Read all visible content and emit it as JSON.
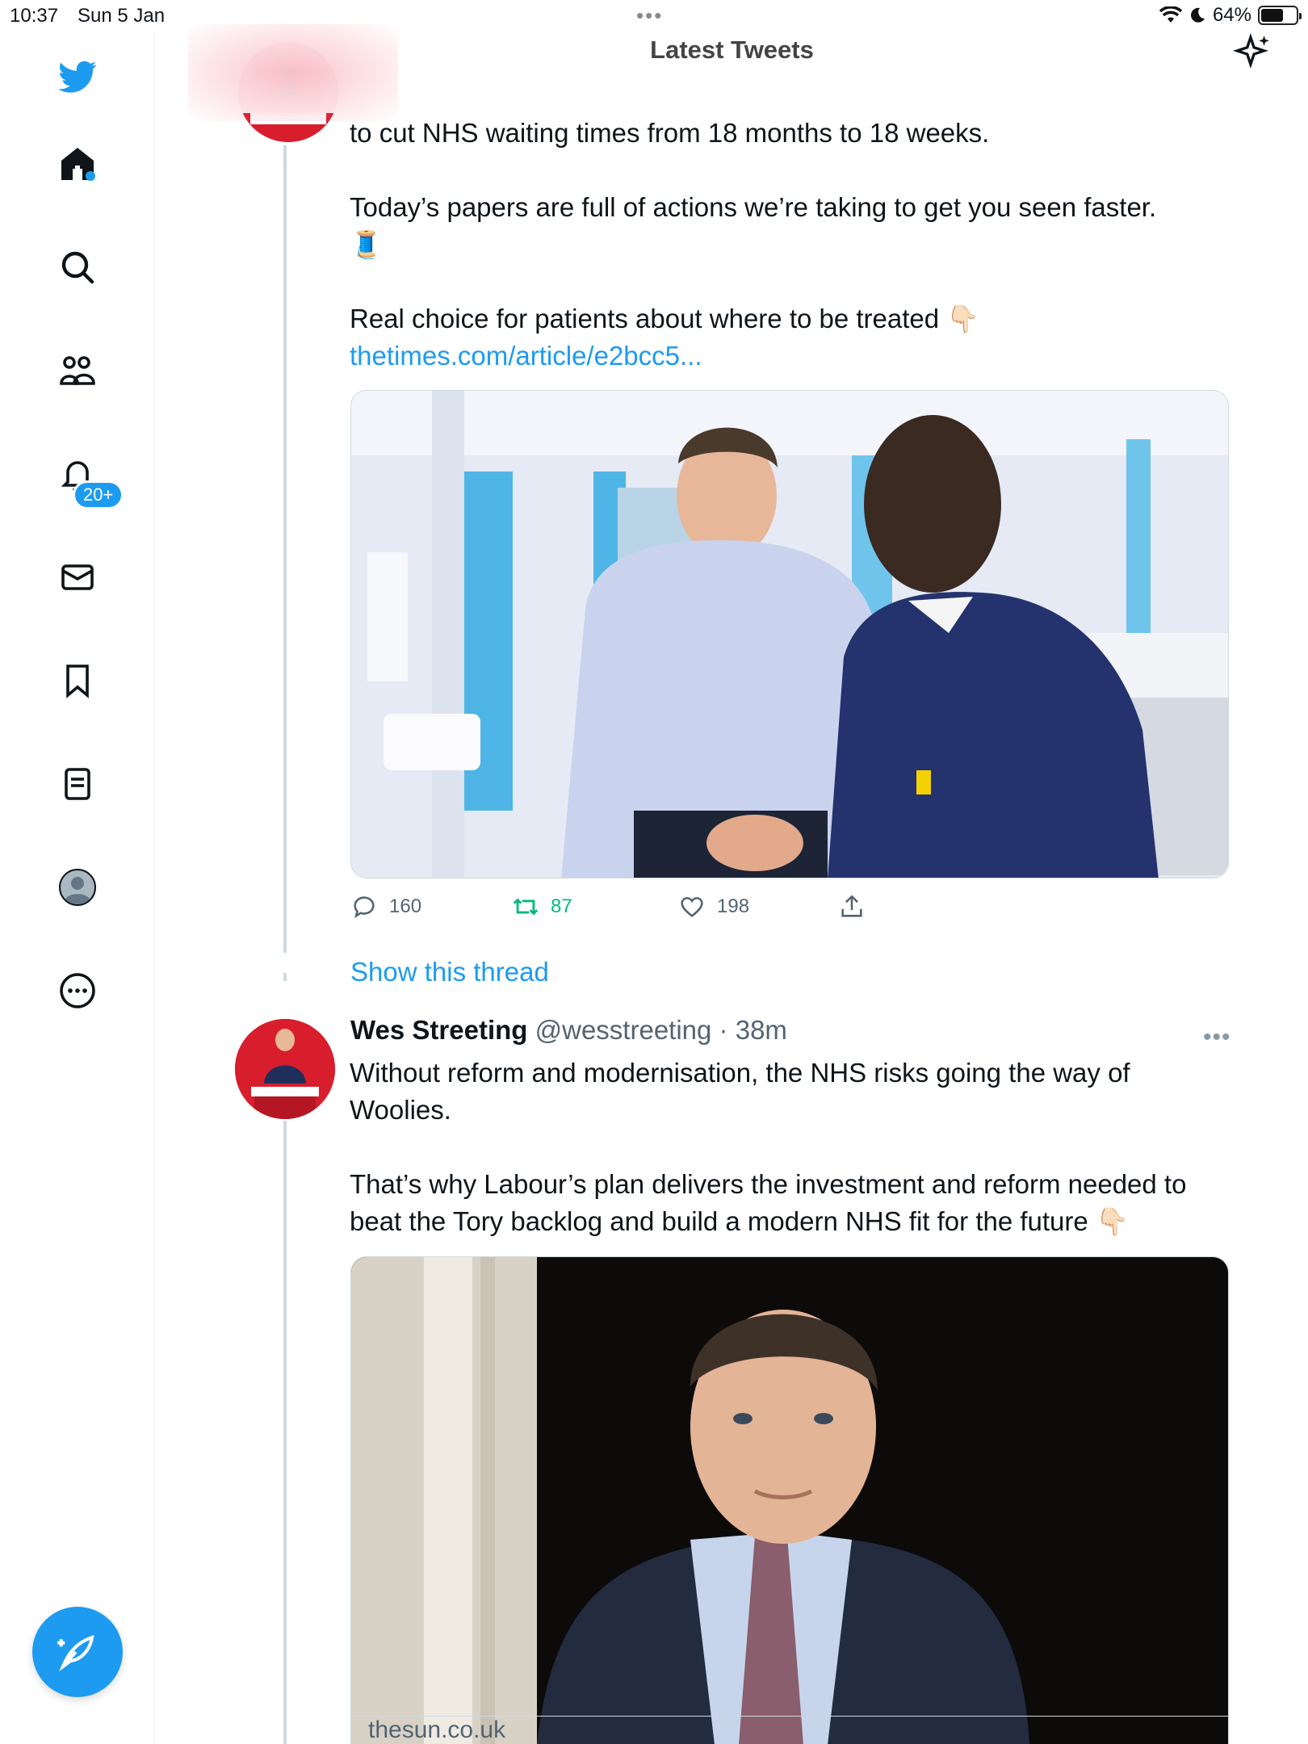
{
  "status": {
    "time": "10:37",
    "date": "Sun 5 Jan",
    "battery": "64%",
    "battery_level": 0.64
  },
  "header": {
    "title": "Latest Tweets"
  },
  "sidebar": {
    "icons": [
      "twitter-logo",
      "home-icon",
      "search-icon",
      "communities-icon",
      "notifications-icon",
      "messages-icon",
      "bookmarks-icon",
      "lists-icon",
      "profile-avatar",
      "more-icon"
    ],
    "notifications_badge": "20+"
  },
  "tweet1": {
    "text_line1": "to cut NHS waiting times from 18 months to 18 weeks.",
    "text_para2": "Today’s papers are full of actions we’re taking to get you seen faster.",
    "emoji1": "🧵",
    "text_para3": "Real choice for patients about where to be treated",
    "emoji_point": "👇🏻",
    "link": "thetimes.com/article/e2bcc5...",
    "replies": "160",
    "retweets": "87",
    "likes": "198",
    "retweet_color": "#00ba7c",
    "show_thread": "Show this thread"
  },
  "tweet2": {
    "name": "Wes Streeting",
    "handle": "@wesstreeting",
    "separator": " · ",
    "time": "38m",
    "para1": "Without reform and modernisation, the NHS risks going the way of Woolies.",
    "para2": "That’s why Labour’s plan delivers the investment and reform needed to beat the Tory backlog and build a modern NHS fit for the future",
    "emoji_point": "👇🏻",
    "card_domain": "thesun.co.uk"
  },
  "colors": {
    "accent": "#1d9bf0",
    "text": "#0f1419",
    "muted": "#536471"
  }
}
